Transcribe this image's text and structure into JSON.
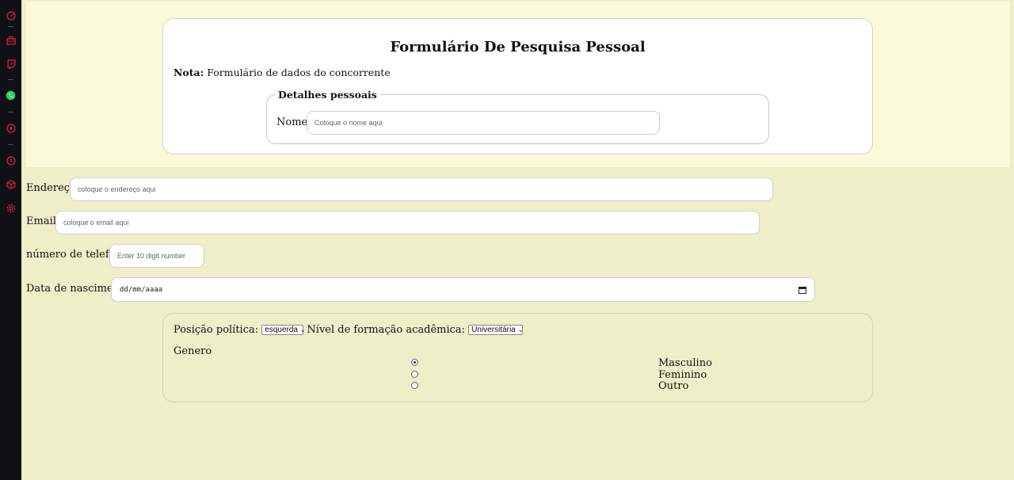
{
  "header": {
    "title": "Formulário De Pesquisa Pessoal",
    "nota_label": "Nota:",
    "nota_text": " Formulário de dados do concorrente"
  },
  "personal": {
    "legend": "Detalhes pessoais",
    "name_label": "Nome:",
    "name_placeholder": "Coloque o nome aqui"
  },
  "form": {
    "address_label": "Endereço:",
    "address_placeholder": "coloque o endereço aqui",
    "email_label": "Email:",
    "email_placeholder": "coloque o email aqui",
    "phone_label": "número de telefone:",
    "phone_placeholder": "Enter 10 digit number",
    "birth_label": "Data de nascimento:",
    "birth_value": "dd/mm/aaaa"
  },
  "prefs": {
    "politics_label": "Posição política:",
    "politics_value": "esquerda",
    "education_label": "Nível de formação acadêmica:",
    "education_value": "Universitária",
    "gender_label": "Genero",
    "gender_options": [
      "Masculino",
      "Feminino",
      "Outro"
    ],
    "gender_selected": "Masculino"
  },
  "sidebar": {
    "icons": [
      "speedometer-icon",
      "briefcase-icon",
      "twitch-icon",
      "whatsapp-icon",
      "play-icon",
      "clock-icon",
      "cube-icon",
      "gear-icon"
    ]
  },
  "colors": {
    "accent": "#e0204a",
    "whatsapp": "#25d366",
    "page_bg": "#eeeec8",
    "band_bg": "#fbfad8",
    "sidebar_bg": "#0f1114"
  }
}
